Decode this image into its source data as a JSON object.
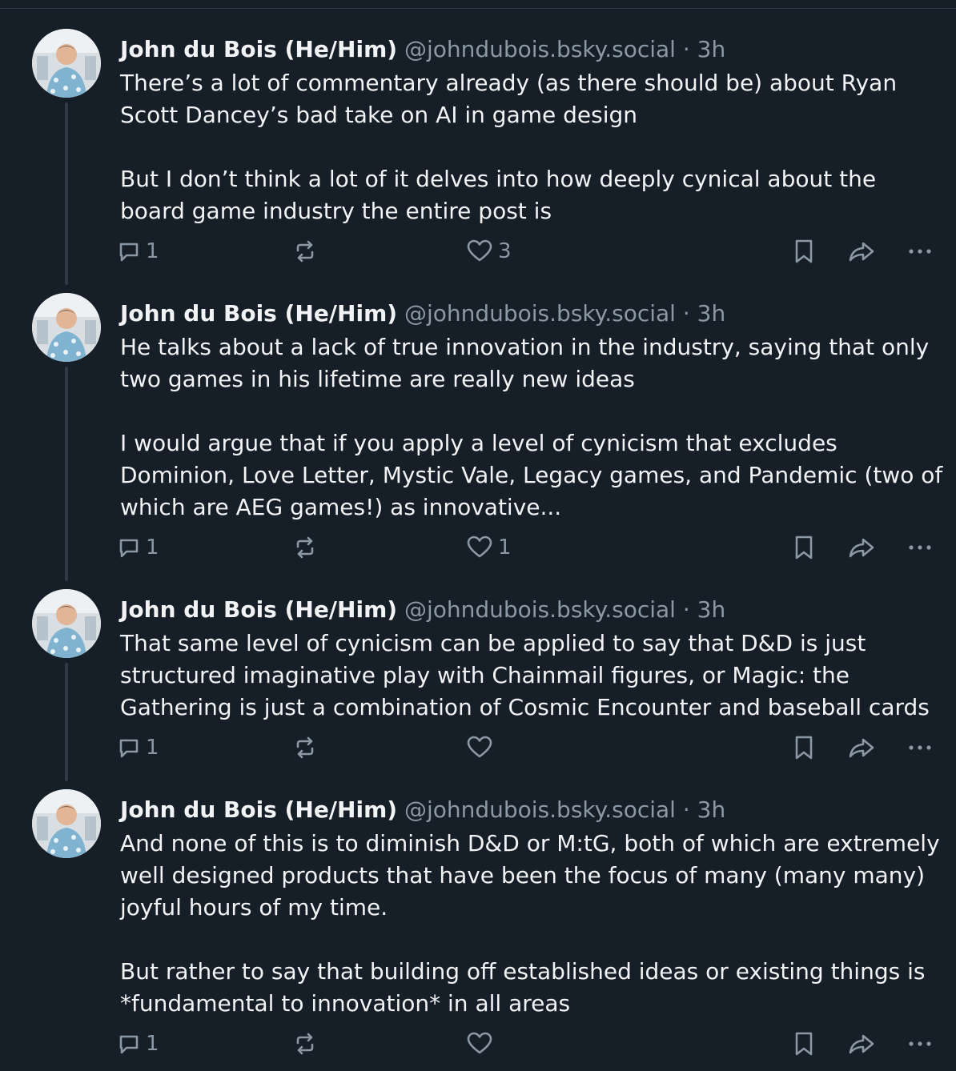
{
  "posts": [
    {
      "author": "John du Bois (He/Him)",
      "handle": "@johndubois.bsky.social",
      "separator": "·",
      "time": "3h",
      "paragraphs": [
        "There’s a lot of commentary already (as there should be) about Ryan Scott Dancey’s bad take on AI in game design",
        "But I don’t think a lot of it delves into how deeply cynical about the board game industry the entire post is"
      ],
      "reply_count": "1",
      "like_count": "3"
    },
    {
      "author": "John du Bois (He/Him)",
      "handle": "@johndubois.bsky.social",
      "separator": "·",
      "time": "3h",
      "paragraphs": [
        "He talks about a lack of true innovation in the industry, saying that only two games in his lifetime are really new ideas",
        "I would argue that if you apply a level of cynicism that excludes Dominion, Love Letter, Mystic Vale, Legacy games, and Pandemic (two of which are AEG games!) as innovative..."
      ],
      "reply_count": "1",
      "like_count": "1"
    },
    {
      "author": "John du Bois (He/Him)",
      "handle": "@johndubois.bsky.social",
      "separator": "·",
      "time": "3h",
      "paragraphs": [
        "That same level of cynicism can be applied to say that D&D is just structured imaginative play with Chainmail figures, or Magic: the Gathering is just a combination of Cosmic Encounter and baseball cards"
      ],
      "reply_count": "1",
      "like_count": ""
    },
    {
      "author": "John du Bois (He/Him)",
      "handle": "@johndubois.bsky.social",
      "separator": "·",
      "time": "3h",
      "paragraphs": [
        "And none of this is to diminish D&D or M:tG, both of which are extremely well designed products that have been the focus of many (many many) joyful hours of my time.",
        "But rather to say that building off established ideas or existing things is *fundamental to innovation* in all areas"
      ],
      "reply_count": "1",
      "like_count": ""
    }
  ],
  "icons": {
    "reply": "speech-bubble-icon",
    "repost": "repost-arrows-icon",
    "like": "heart-icon",
    "bookmark": "bookmark-icon",
    "share": "share-arrow-icon",
    "more": "ellipsis-icon"
  },
  "colors": {
    "background": "#161e27",
    "text": "#f1f3f5",
    "muted": "#8b98a5",
    "thread_line": "#2e3a47"
  }
}
